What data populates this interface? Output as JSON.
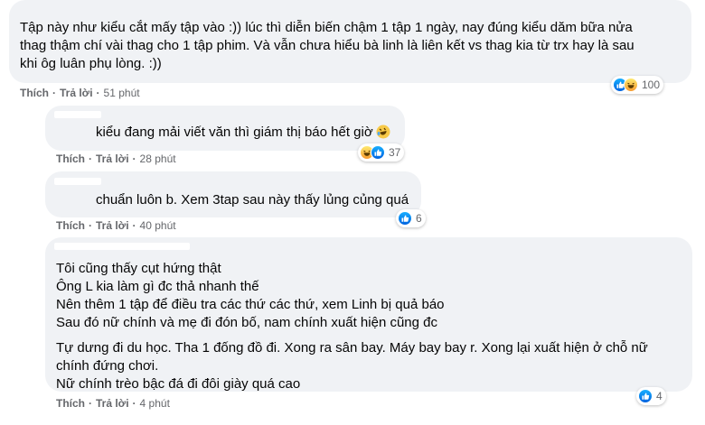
{
  "comments": [
    {
      "lines": [
        "Tập này như kiểu cắt mấy tập vào :)) lúc thì diễn biến chậm 1 tập 1 ngày, nay đúng kiểu dăm bữa nửa",
        "thag thậm chí vài thag cho 1 tập phim. Và vẫn chưa hiểu bà linh là liên kết vs thag kia từ trx hay là sau",
        "khi ôg luân phụ lòng. :))"
      ],
      "like_label": "Thích",
      "reply_label": "Trả lời",
      "time": "51 phút",
      "reaction_count": "100",
      "reactions": [
        "like-icon",
        "haha-icon"
      ]
    },
    {
      "lines": [
        "kiểu đang mải viết văn thì giám thị báo hết giờ"
      ],
      "inline_emoji": "rofl-emoji-icon",
      "like_label": "Thích",
      "reply_label": "Trả lời",
      "time": "28 phút",
      "reaction_count": "37",
      "reactions": [
        "haha-icon",
        "like-icon"
      ]
    },
    {
      "lines": [
        "chuẩn luôn b. Xem 3tap sau này thấy lủng củng quá"
      ],
      "like_label": "Thích",
      "reply_label": "Trả lời",
      "time": "40 phút",
      "reaction_count": "6",
      "reactions": [
        "like-icon"
      ]
    },
    {
      "lines": [
        "Tôi cũng thấy cụt hứng thật",
        "Ông L kia làm gì đc thả nhanh thế",
        "Nên thêm 1 tập để điều tra các thứ các thứ, xem Linh bị quả báo",
        "Sau đó nữ chính và mẹ đi đón bố, nam chính xuất hiện cũng đc",
        "Tự dưng đi du học. Tha 1 đống đồ đi. Xong ra sân bay. Máy bay bay r. Xong lại xuất hiện ở chỗ nữ",
        "chính đứng chơi.",
        "Nữ chính trèo bậc đá đi đôi giày quá cao"
      ],
      "like_label": "Thích",
      "reply_label": "Trả lời",
      "time": "4 phút",
      "reaction_count": "4",
      "reactions": [
        "like-icon"
      ]
    }
  ]
}
